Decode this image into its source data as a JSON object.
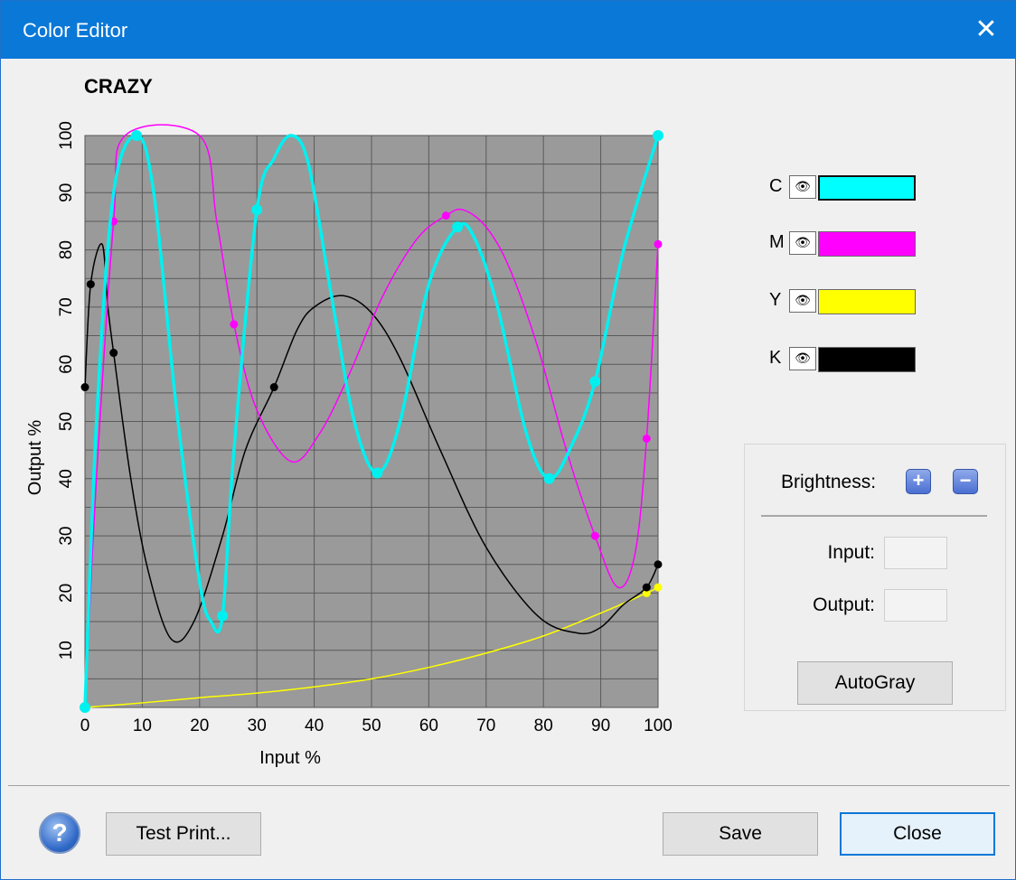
{
  "window": {
    "title": "Color Editor",
    "close_glyph": "✕"
  },
  "chart_title": "CRAZY",
  "chart_data": {
    "type": "line",
    "xlabel": "Input %",
    "ylabel": "Output %",
    "xlim": [
      0,
      100
    ],
    "ylim": [
      0,
      100
    ],
    "x_ticks": [
      "0",
      "10",
      "20",
      "30",
      "40",
      "50",
      "60",
      "70",
      "80",
      "90",
      "100"
    ],
    "y_ticks": [
      "10",
      "20",
      "30",
      "40",
      "50",
      "60",
      "70",
      "80",
      "90",
      "100"
    ],
    "grid": true,
    "background": "#9a9a9a",
    "series": [
      {
        "channel": "C",
        "color": "#00f0f0",
        "width": 3.5,
        "points": [
          [
            0,
            0
          ],
          [
            2,
            50
          ],
          [
            5,
            90
          ],
          [
            9,
            100
          ],
          [
            12,
            90
          ],
          [
            16,
            52
          ],
          [
            20,
            22
          ],
          [
            22,
            15
          ],
          [
            24,
            16
          ],
          [
            26,
            45
          ],
          [
            30,
            87
          ],
          [
            33,
            96
          ],
          [
            36,
            100
          ],
          [
            39,
            95
          ],
          [
            43,
            72
          ],
          [
            47,
            50
          ],
          [
            51,
            41
          ],
          [
            55,
            50
          ],
          [
            60,
            74
          ],
          [
            65,
            84
          ],
          [
            68,
            82
          ],
          [
            72,
            70
          ],
          [
            77,
            48
          ],
          [
            81,
            40
          ],
          [
            85,
            46
          ],
          [
            89,
            57
          ],
          [
            94,
            80
          ],
          [
            100,
            100
          ]
        ],
        "markers": [
          [
            0,
            0
          ],
          [
            9,
            100
          ],
          [
            24,
            16
          ],
          [
            30,
            87
          ],
          [
            65,
            84
          ],
          [
            51,
            41
          ],
          [
            81,
            40
          ],
          [
            89,
            57
          ],
          [
            100,
            100
          ]
        ]
      },
      {
        "channel": "M",
        "color": "#ff00ff",
        "width": 1.5,
        "points": [
          [
            0,
            0
          ],
          [
            2,
            40
          ],
          [
            5,
            85
          ],
          [
            7,
            100
          ],
          [
            20,
            100
          ],
          [
            23,
            85
          ],
          [
            26,
            67
          ],
          [
            30,
            52
          ],
          [
            36,
            43
          ],
          [
            41,
            48
          ],
          [
            46,
            58
          ],
          [
            52,
            72
          ],
          [
            58,
            82
          ],
          [
            63,
            86
          ],
          [
            66,
            87
          ],
          [
            70,
            84
          ],
          [
            74,
            77
          ],
          [
            79,
            63
          ],
          [
            84,
            45
          ],
          [
            89,
            30
          ],
          [
            93,
            21
          ],
          [
            96,
            27
          ],
          [
            98,
            47
          ],
          [
            100,
            81
          ]
        ],
        "markers": [
          [
            5,
            85
          ],
          [
            26,
            67
          ],
          [
            63,
            86
          ],
          [
            89,
            30
          ],
          [
            98,
            47
          ],
          [
            100,
            81
          ]
        ]
      },
      {
        "channel": "K",
        "color": "#000000",
        "width": 1.5,
        "points": [
          [
            0,
            56
          ],
          [
            1,
            74
          ],
          [
            3,
            81
          ],
          [
            4,
            70
          ],
          [
            5,
            62
          ],
          [
            8,
            40
          ],
          [
            11,
            24
          ],
          [
            15,
            12
          ],
          [
            19,
            15
          ],
          [
            24,
            30
          ],
          [
            28,
            45
          ],
          [
            33,
            56
          ],
          [
            37,
            66
          ],
          [
            40,
            70
          ],
          [
            45,
            72
          ],
          [
            50,
            69
          ],
          [
            55,
            61
          ],
          [
            62,
            45
          ],
          [
            70,
            28
          ],
          [
            79,
            16
          ],
          [
            86,
            13
          ],
          [
            90,
            14
          ],
          [
            94,
            18
          ],
          [
            98,
            21
          ],
          [
            100,
            25
          ]
        ],
        "markers": [
          [
            0,
            56
          ],
          [
            1,
            74
          ],
          [
            5,
            62
          ],
          [
            33,
            56
          ],
          [
            98,
            21
          ],
          [
            100,
            25
          ]
        ]
      },
      {
        "channel": "Y",
        "color": "#ffff00",
        "width": 1.5,
        "points": [
          [
            0,
            0
          ],
          [
            10,
            0.8
          ],
          [
            20,
            1.7
          ],
          [
            30,
            2.5
          ],
          [
            40,
            3.6
          ],
          [
            50,
            5
          ],
          [
            60,
            7
          ],
          [
            70,
            9.5
          ],
          [
            80,
            12.5
          ],
          [
            90,
            16.5
          ],
          [
            98,
            20
          ],
          [
            100,
            21
          ]
        ],
        "markers": [
          [
            98,
            20
          ],
          [
            100,
            21
          ]
        ]
      }
    ]
  },
  "channels": [
    {
      "letter": "C",
      "eye": "👁",
      "color": "#00ffff",
      "visibility_icon": "eye-icon"
    },
    {
      "letter": "M",
      "eye": "👁",
      "color": "#ff00ff",
      "visibility_icon": "eye-icon"
    },
    {
      "letter": "Y",
      "eye": "👁",
      "color": "#ffff00",
      "visibility_icon": "eye-icon"
    },
    {
      "letter": "K",
      "eye": "👁",
      "color": "#000000",
      "visibility_icon": "eye-icon"
    }
  ],
  "panel": {
    "brightness_label": "Brightness:",
    "plus_glyph": "+",
    "minus_glyph": "−",
    "input_label": "Input:",
    "output_label": "Output:",
    "input_value": "",
    "output_value": "",
    "autogray_label": "AutoGray"
  },
  "footer": {
    "help_glyph": "?",
    "test_print_label": "Test Print...",
    "save_label": "Save",
    "close_label": "Close"
  }
}
